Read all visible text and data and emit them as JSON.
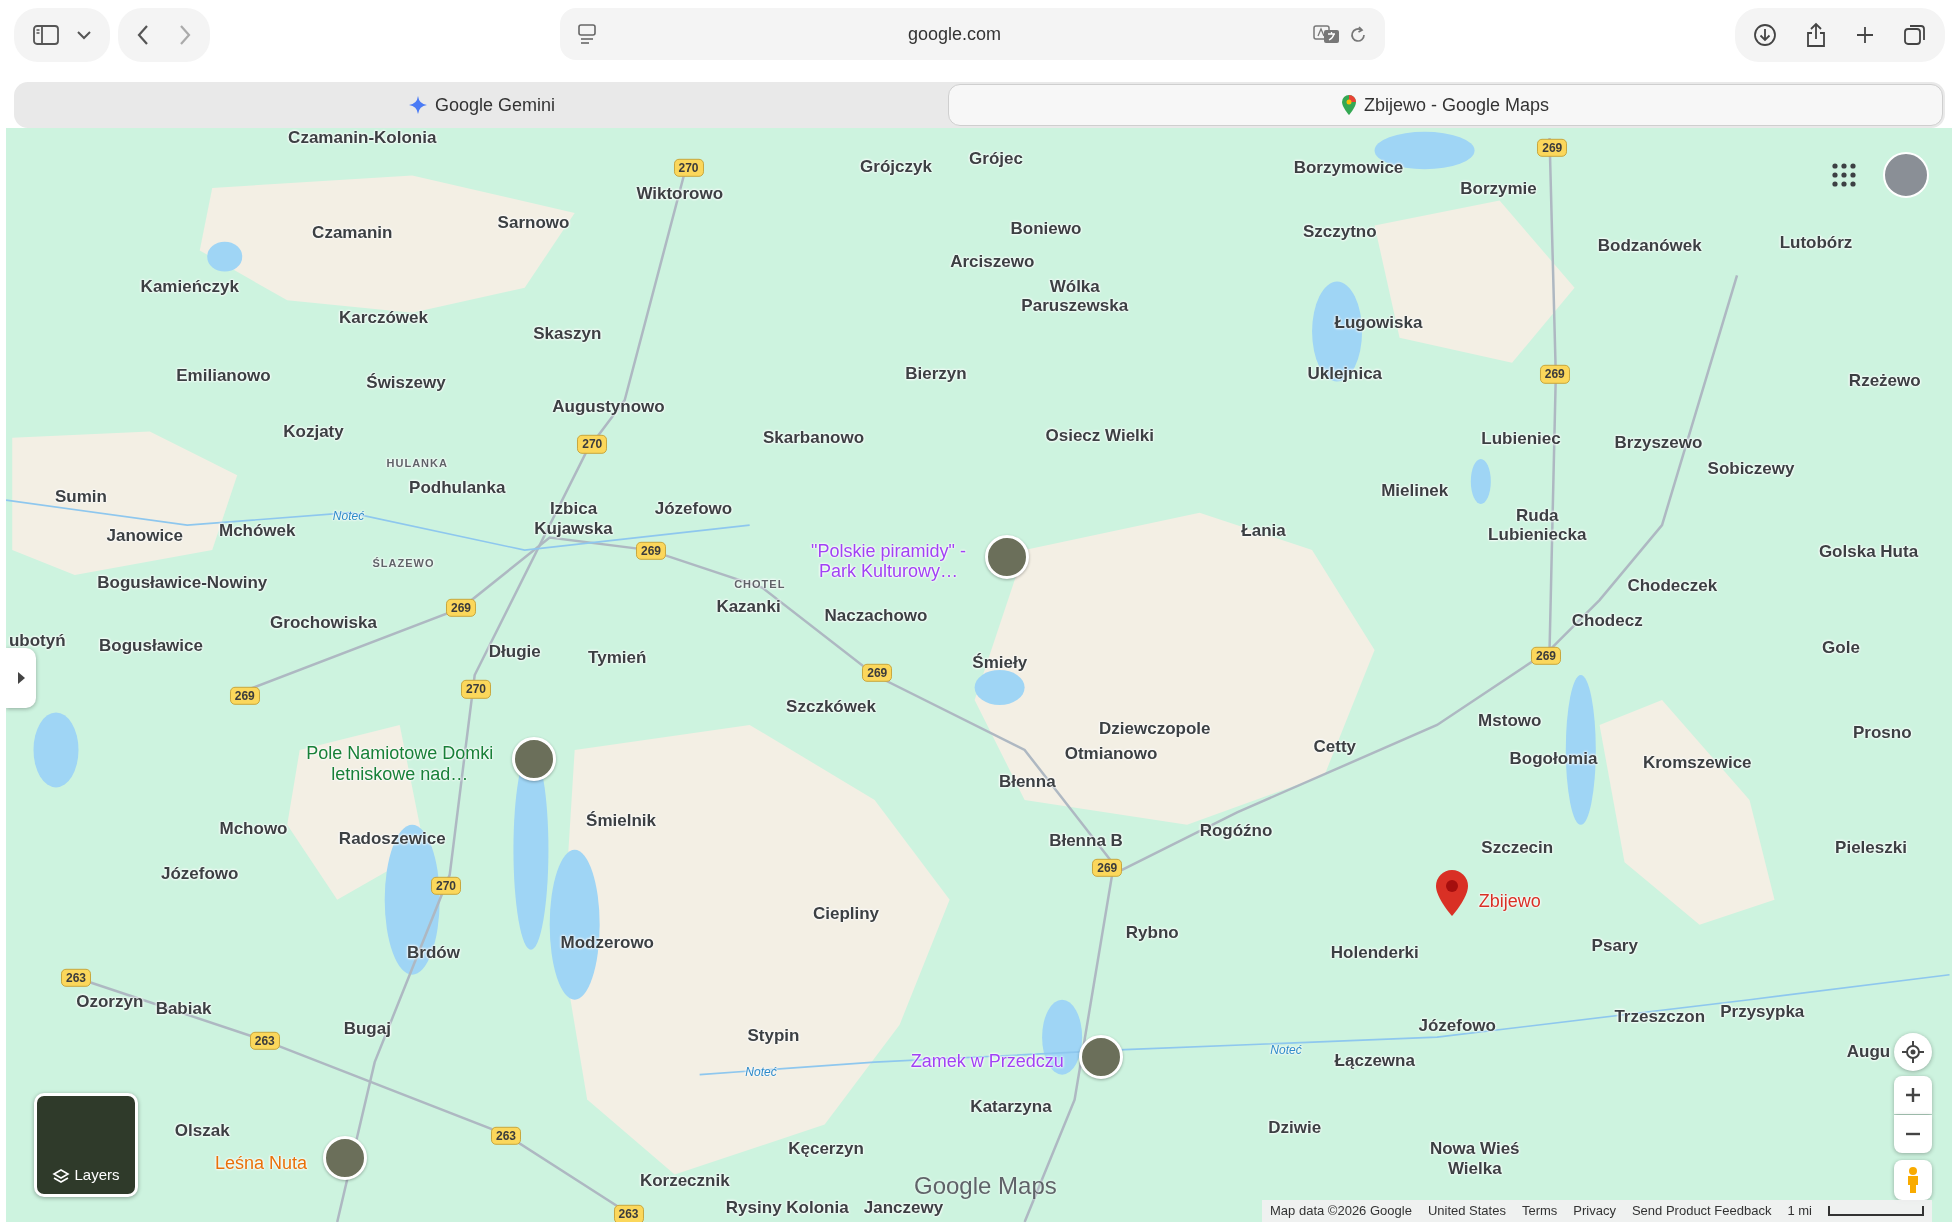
{
  "browser": {
    "address": "google.com",
    "tabs": [
      {
        "title": "Google Gemini",
        "selected": false
      },
      {
        "title": "Zbijewo - Google Maps",
        "selected": true
      }
    ]
  },
  "map": {
    "places": [
      {
        "name": "Czamanin-Kolonia",
        "kind": "place"
      },
      {
        "name": "Grójczyk",
        "kind": "place"
      },
      {
        "name": "Grójec",
        "kind": "place"
      },
      {
        "name": "Wiktorowo",
        "kind": "place"
      },
      {
        "name": "Borzymowice",
        "kind": "place"
      },
      {
        "name": "Borzymie",
        "kind": "place"
      },
      {
        "name": "Czamanin",
        "kind": "place"
      },
      {
        "name": "Sarnowo",
        "kind": "place"
      },
      {
        "name": "Boniewo",
        "kind": "place"
      },
      {
        "name": "Szczytno",
        "kind": "place"
      },
      {
        "name": "Bodzanówek",
        "kind": "place"
      },
      {
        "name": "Lutobórz",
        "kind": "place"
      },
      {
        "name": "Kamieńczyk",
        "kind": "place"
      },
      {
        "name": "Arciszewo",
        "kind": "place"
      },
      {
        "name": "Wólka Paruszewska",
        "kind": "place"
      },
      {
        "name": "Karczówek",
        "kind": "place"
      },
      {
        "name": "Skaszyn",
        "kind": "place"
      },
      {
        "name": "Ługowiska",
        "kind": "place"
      },
      {
        "name": "Emilianowo",
        "kind": "place"
      },
      {
        "name": "Świszewy",
        "kind": "place"
      },
      {
        "name": "Bierzyn",
        "kind": "place"
      },
      {
        "name": "Uklejnica",
        "kind": "place"
      },
      {
        "name": "Rzeżewo",
        "kind": "place"
      },
      {
        "name": "Augustynowo",
        "kind": "place"
      },
      {
        "name": "Kozjaty",
        "kind": "place"
      },
      {
        "name": "Skarbanowo",
        "kind": "place"
      },
      {
        "name": "Osiecz Wielki",
        "kind": "place"
      },
      {
        "name": "Lubieniec",
        "kind": "place"
      },
      {
        "name": "Brzyszewo",
        "kind": "place"
      },
      {
        "name": "Sobiczewy",
        "kind": "place"
      },
      {
        "name": "HULANKA",
        "kind": "hamlet"
      },
      {
        "name": "Sumin",
        "kind": "place"
      },
      {
        "name": "Podhulanka",
        "kind": "place"
      },
      {
        "name": "Mielinek",
        "kind": "place"
      },
      {
        "name": "Janowice",
        "kind": "place"
      },
      {
        "name": "Mchówek",
        "kind": "place"
      },
      {
        "name": "Noteć",
        "kind": "river"
      },
      {
        "name": "Izbica Kujawska",
        "kind": "place"
      },
      {
        "name": "Józefowo",
        "kind": "place"
      },
      {
        "name": "Łania",
        "kind": "place"
      },
      {
        "name": "Ruda Lubieniecka",
        "kind": "place"
      },
      {
        "name": "Golska Huta",
        "kind": "place"
      },
      {
        "name": "ŚLAZEWO",
        "kind": "hamlet"
      },
      {
        "name": "\"Polskie piramidy\" - Park Kulturowy…",
        "kind": "poi",
        "color": "#a142f4"
      },
      {
        "name": "Bogusławice-Nowiny",
        "kind": "place"
      },
      {
        "name": "CHOTEL",
        "kind": "hamlet"
      },
      {
        "name": "Chodeczek",
        "kind": "place"
      },
      {
        "name": "Kazanki",
        "kind": "place"
      },
      {
        "name": "Naczachowo",
        "kind": "place"
      },
      {
        "name": "Grochowiska",
        "kind": "place"
      },
      {
        "name": "Chodecz",
        "kind": "place"
      },
      {
        "name": "ubotyń",
        "kind": "place"
      },
      {
        "name": "Bogusławice",
        "kind": "place"
      },
      {
        "name": "Długie",
        "kind": "place"
      },
      {
        "name": "Tymień",
        "kind": "place"
      },
      {
        "name": "Śmieły",
        "kind": "place"
      },
      {
        "name": "Gole",
        "kind": "place"
      },
      {
        "name": "Szczkówek",
        "kind": "place"
      },
      {
        "name": "Mstowo",
        "kind": "place"
      },
      {
        "name": "Dziewczopole",
        "kind": "place"
      },
      {
        "name": "Prosno",
        "kind": "place"
      },
      {
        "name": "Pole Namiotowe Domki letniskowe nad…",
        "kind": "poi",
        "color": "#188038"
      },
      {
        "name": "Otmianowo",
        "kind": "place"
      },
      {
        "name": "Cetty",
        "kind": "place"
      },
      {
        "name": "Bogołomia",
        "kind": "place"
      },
      {
        "name": "Kromszewice",
        "kind": "place"
      },
      {
        "name": "Błenna",
        "kind": "place"
      },
      {
        "name": "Śmielnik",
        "kind": "place"
      },
      {
        "name": "Mchowo",
        "kind": "place"
      },
      {
        "name": "Rogóźno",
        "kind": "place"
      },
      {
        "name": "Radoszewice",
        "kind": "place"
      },
      {
        "name": "Błenna B",
        "kind": "place"
      },
      {
        "name": "Szczecin",
        "kind": "place"
      },
      {
        "name": "Pieleszki",
        "kind": "place"
      },
      {
        "name": "Józefowo",
        "kind": "place"
      },
      {
        "name": "Zbijewo",
        "kind": "pin",
        "color": "#d93025"
      },
      {
        "name": "Ciepliny",
        "kind": "place"
      },
      {
        "name": "Modzerowo",
        "kind": "place"
      },
      {
        "name": "Rybno",
        "kind": "place"
      },
      {
        "name": "Brdów",
        "kind": "place"
      },
      {
        "name": "Holenderki",
        "kind": "place"
      },
      {
        "name": "Psary",
        "kind": "place"
      },
      {
        "name": "Ozorzyn",
        "kind": "place"
      },
      {
        "name": "Babiak",
        "kind": "place"
      },
      {
        "name": "Trzeszczon",
        "kind": "place"
      },
      {
        "name": "Przysypka",
        "kind": "place"
      },
      {
        "name": "Bugaj",
        "kind": "place"
      },
      {
        "name": "Józefowo",
        "kind": "place"
      },
      {
        "name": "Augu",
        "kind": "place"
      },
      {
        "name": "Stypin",
        "kind": "place"
      },
      {
        "name": "Noteć",
        "kind": "river"
      },
      {
        "name": "Noteć",
        "kind": "river"
      },
      {
        "name": "Zamek w Przedczu",
        "kind": "poi",
        "color": "#a142f4"
      },
      {
        "name": "Łączewna",
        "kind": "place"
      },
      {
        "name": "Katarzyna",
        "kind": "place"
      },
      {
        "name": "Olszak",
        "kind": "place"
      },
      {
        "name": "Dziwie",
        "kind": "place"
      },
      {
        "name": "Leśna Nuta",
        "kind": "poi",
        "color": "#e8710a"
      },
      {
        "name": "Kęcerzyn",
        "kind": "place"
      },
      {
        "name": "Nowa Wieś Wielka",
        "kind": "place"
      },
      {
        "name": "Korzecznik",
        "kind": "place"
      },
      {
        "name": "Janczewy",
        "kind": "place"
      },
      {
        "name": "Rysiny Kolonia",
        "kind": "place"
      }
    ],
    "road_shields": [
      "270",
      "270",
      "270",
      "270",
      "269",
      "269",
      "269",
      "269",
      "269",
      "269",
      "269",
      "269",
      "263",
      "263",
      "263",
      "263"
    ],
    "layers_button": "Layers",
    "logo": "Google Maps",
    "footer": [
      "Map data ©2026 Google",
      "United States",
      "Terms",
      "Privacy",
      "Send Product Feedback"
    ],
    "scale": "1 mi"
  }
}
